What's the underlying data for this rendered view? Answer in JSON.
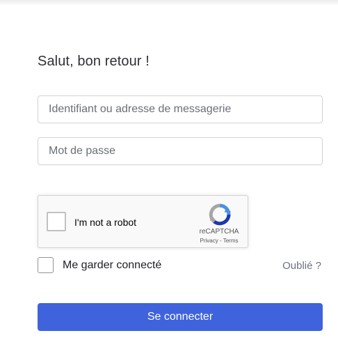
{
  "form": {
    "title": "Salut, bon retour !",
    "login_placeholder": "Identifiant ou adresse de messagerie",
    "login_value": "",
    "password_placeholder": "Mot de passe",
    "password_value": "",
    "remember_label": "Me garder connecté",
    "remember_checked": false,
    "forgot_label": "Oublié ?",
    "submit_label": "Se connecter"
  },
  "recaptcha": {
    "label": "I'm not a robot",
    "checked": false,
    "brand": "reCAPTCHA",
    "privacy_label": "Privacy",
    "separator": " - ",
    "terms_label": "Terms",
    "logo_icon": "recaptcha-logo-icon"
  },
  "colors": {
    "accent": "#3f63dd",
    "text": "#2f3035",
    "muted_link": "#6b7280",
    "border": "#cfd2d6"
  }
}
